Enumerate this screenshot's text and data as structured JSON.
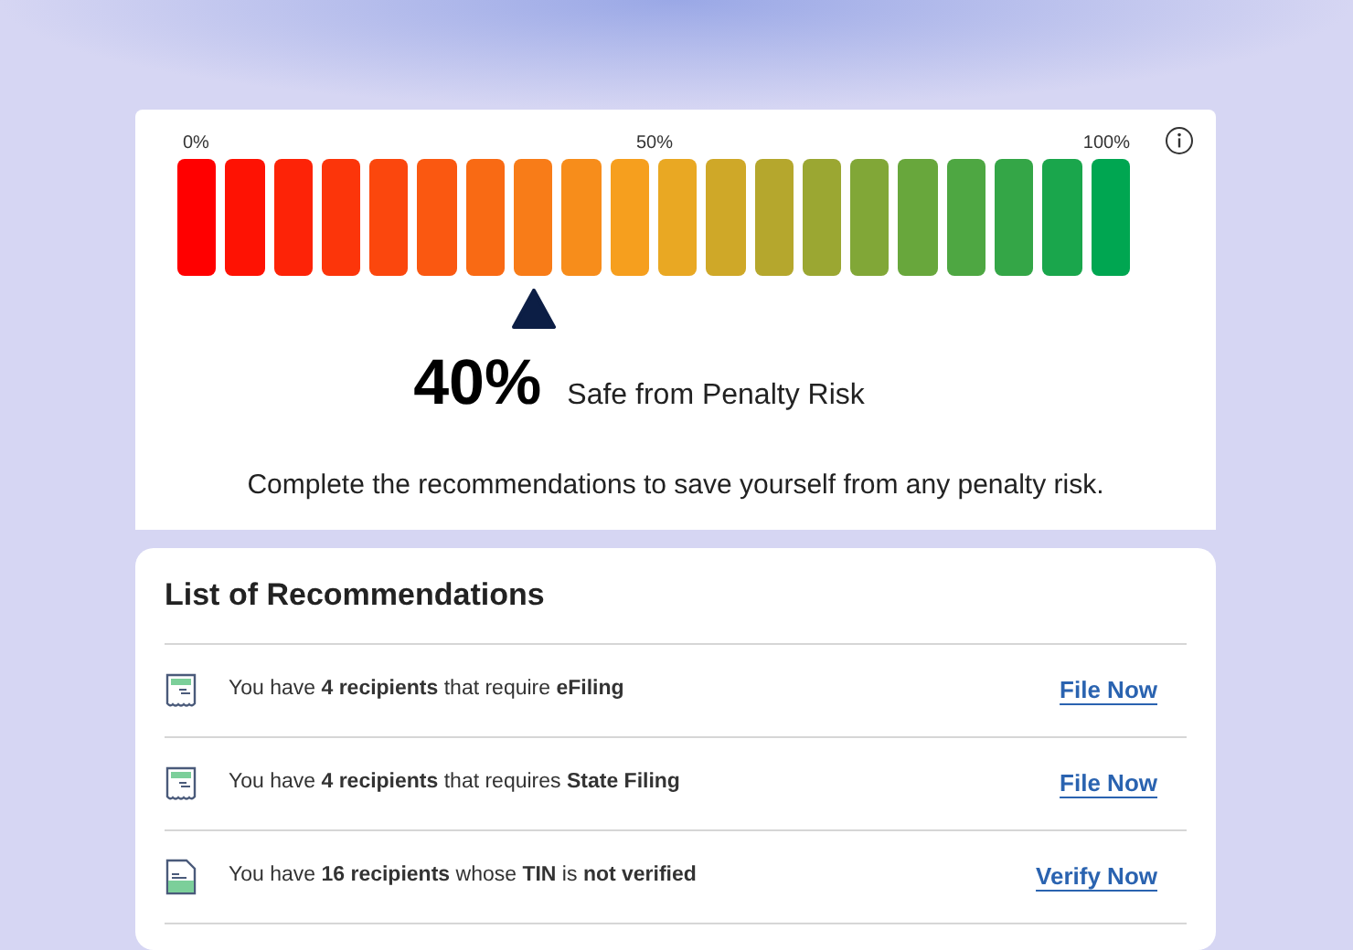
{
  "meter": {
    "labels": [
      "0%",
      "50%",
      "100%"
    ],
    "percent": "40%",
    "caption": "Safe from Penalty Risk",
    "message": "Complete the recommendations to save yourself from any penalty risk."
  },
  "recommendations": {
    "title": "List of Recommendations",
    "items": [
      {
        "kind": "receipt",
        "text": "You have **4 recipients** that require **eFiling**",
        "action": "File Now"
      },
      {
        "kind": "receipt",
        "text": "You have **4 recipients** that requires **State Filing**",
        "action": "File Now"
      },
      {
        "kind": "document",
        "text": "You have **16 recipients** whose **TIN** is **not verified**",
        "action": "Verify Now"
      }
    ]
  }
}
